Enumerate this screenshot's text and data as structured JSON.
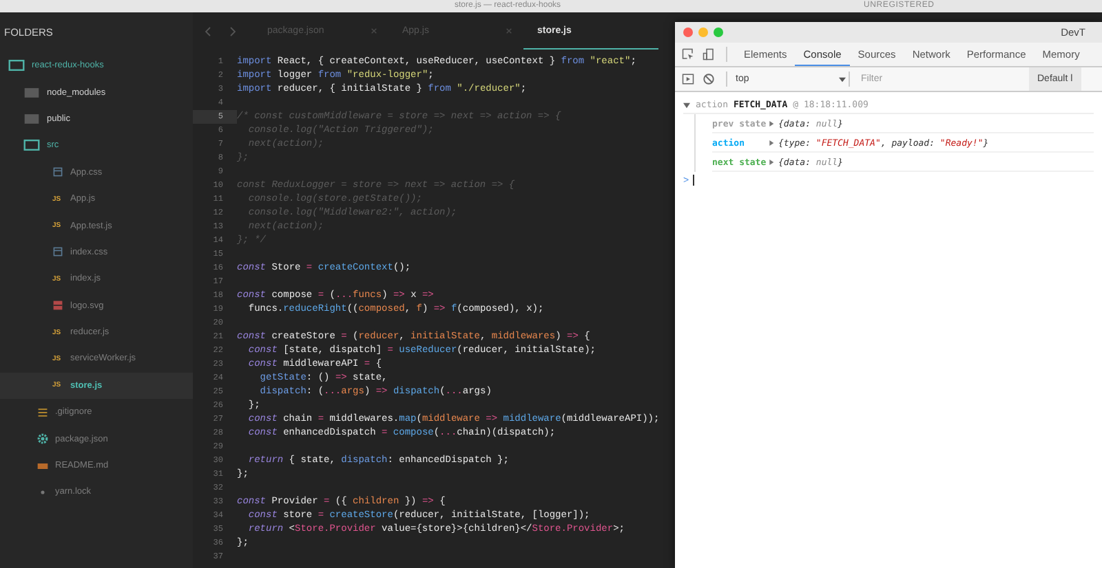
{
  "window": {
    "title": "store.js — react-redux-hooks",
    "license": "UNREGISTERED"
  },
  "sidebar": {
    "heading": "FOLDERS",
    "items": [
      {
        "name": "react-redux-hooks",
        "kind": "folder",
        "expanded": true,
        "selected": false,
        "children": [
          {
            "name": "node_modules",
            "kind": "folder",
            "expanded": false,
            "selected": false
          },
          {
            "name": "public",
            "kind": "folder",
            "expanded": false,
            "selected": false
          },
          {
            "name": "src",
            "kind": "folder",
            "expanded": true,
            "selected": false,
            "children": [
              {
                "name": "App.css",
                "kind": "css",
                "selected": false
              },
              {
                "name": "App.js",
                "kind": "js",
                "badge": "JS",
                "selected": false
              },
              {
                "name": "App.test.js",
                "kind": "js",
                "badge": "JS",
                "selected": false
              },
              {
                "name": "index.css",
                "kind": "css",
                "selected": false
              },
              {
                "name": "index.js",
                "kind": "js",
                "badge": "JS",
                "selected": false
              },
              {
                "name": "logo.svg",
                "kind": "image",
                "selected": false
              },
              {
                "name": "reducer.js",
                "kind": "js",
                "badge": "JS",
                "selected": false
              },
              {
                "name": "serviceWorker.js",
                "kind": "js",
                "badge": "JS",
                "selected": false
              },
              {
                "name": "store.js",
                "kind": "js",
                "badge": "JS",
                "selected": true
              }
            ]
          },
          {
            "name": ".gitignore",
            "kind": "text",
            "selected": false
          },
          {
            "name": "package.json",
            "kind": "json",
            "selected": false
          },
          {
            "name": "README.md",
            "kind": "markdown",
            "selected": false
          },
          {
            "name": "yarn.lock",
            "kind": "lock",
            "selected": false
          }
        ]
      }
    ]
  },
  "tabs": [
    {
      "label": "package.json",
      "selected": false
    },
    {
      "label": "App.js",
      "selected": false
    },
    {
      "label": "store.js",
      "selected": true
    }
  ],
  "code": [
    {
      "number": "1",
      "current": false,
      "tokens": [
        {
          "kind": "module",
          "text": "import"
        },
        {
          "kind": "plain",
          "text": " React, { createContext, useReducer, useContext } "
        },
        {
          "kind": "module",
          "text": "from"
        },
        {
          "kind": "string",
          "text": " \"react\""
        },
        {
          "kind": "plain",
          "text": ";"
        }
      ]
    },
    {
      "number": "2",
      "current": false,
      "tokens": [
        {
          "kind": "module",
          "text": "import"
        },
        {
          "kind": "plain",
          "text": " logger "
        },
        {
          "kind": "module",
          "text": "from"
        },
        {
          "kind": "string",
          "text": " \"redux-logger\""
        },
        {
          "kind": "plain",
          "text": ";"
        }
      ]
    },
    {
      "number": "3",
      "current": false,
      "tokens": [
        {
          "kind": "module",
          "text": "import"
        },
        {
          "kind": "plain",
          "text": " reducer, { initialState } "
        },
        {
          "kind": "module",
          "text": "from"
        },
        {
          "kind": "string",
          "text": " \"./reducer\""
        },
        {
          "kind": "plain",
          "text": ";"
        }
      ]
    },
    {
      "number": "4",
      "current": false
    },
    {
      "number": "5",
      "current": true,
      "tokens": [
        {
          "kind": "comment",
          "text": "/* const customMiddleware = store => next => action => {"
        }
      ]
    },
    {
      "number": "6",
      "current": false,
      "tokens": [
        {
          "kind": "comment",
          "text": "  console.log(\"Action Triggered\");"
        }
      ]
    },
    {
      "number": "7",
      "current": false,
      "tokens": [
        {
          "kind": "comment",
          "text": "  next(action);"
        }
      ]
    },
    {
      "number": "8",
      "current": false,
      "tokens": [
        {
          "kind": "comment",
          "text": "};"
        }
      ]
    },
    {
      "number": "9",
      "current": false
    },
    {
      "number": "10",
      "current": false,
      "tokens": [
        {
          "kind": "comment",
          "text": "const ReduxLogger = store => next => action => {"
        }
      ]
    },
    {
      "number": "11",
      "current": false,
      "tokens": [
        {
          "kind": "comment",
          "text": "  console.log(store.getState());"
        }
      ]
    },
    {
      "number": "12",
      "current": false,
      "tokens": [
        {
          "kind": "comment",
          "text": "  console.log(\"Middleware2:\", action);"
        }
      ]
    },
    {
      "number": "13",
      "current": false,
      "tokens": [
        {
          "kind": "comment",
          "text": "  next(action);"
        }
      ]
    },
    {
      "number": "14",
      "current": false,
      "tokens": [
        {
          "kind": "comment",
          "text": "}; */"
        }
      ]
    },
    {
      "number": "15",
      "current": false
    },
    {
      "number": "16",
      "current": false,
      "tokens": [
        {
          "kind": "keyword",
          "text": "const"
        },
        {
          "kind": "plain",
          "text": " Store "
        },
        {
          "kind": "operator",
          "text": "="
        },
        {
          "kind": "call",
          "text": " createContext"
        },
        {
          "kind": "plain",
          "text": "();"
        }
      ]
    },
    {
      "number": "17",
      "current": false
    },
    {
      "number": "18",
      "current": false,
      "tokens": [
        {
          "kind": "keyword",
          "text": "const"
        },
        {
          "kind": "plain",
          "text": " compose "
        },
        {
          "kind": "operator",
          "text": "="
        },
        {
          "kind": "plain",
          "text": " ("
        },
        {
          "kind": "operator",
          "text": "..."
        },
        {
          "kind": "param",
          "text": "funcs"
        },
        {
          "kind": "plain",
          "text": ") "
        },
        {
          "kind": "operator",
          "text": "=>"
        },
        {
          "kind": "plain",
          "text": " x "
        },
        {
          "kind": "operator",
          "text": "=>"
        }
      ]
    },
    {
      "number": "19",
      "current": false,
      "tokens": [
        {
          "kind": "plain",
          "text": "  funcs."
        },
        {
          "kind": "call",
          "text": "reduceRight"
        },
        {
          "kind": "plain",
          "text": "(("
        },
        {
          "kind": "param",
          "text": "composed"
        },
        {
          "kind": "plain",
          "text": ", "
        },
        {
          "kind": "param",
          "text": "f"
        },
        {
          "kind": "plain",
          "text": ") "
        },
        {
          "kind": "operator",
          "text": "=>"
        },
        {
          "kind": "call",
          "text": " f"
        },
        {
          "kind": "plain",
          "text": "(composed), x);"
        }
      ]
    },
    {
      "number": "20",
      "current": false
    },
    {
      "number": "21",
      "current": false,
      "tokens": [
        {
          "kind": "keyword",
          "text": "const"
        },
        {
          "kind": "plain",
          "text": " createStore "
        },
        {
          "kind": "operator",
          "text": "="
        },
        {
          "kind": "plain",
          "text": " ("
        },
        {
          "kind": "param",
          "text": "reducer"
        },
        {
          "kind": "plain",
          "text": ", "
        },
        {
          "kind": "param",
          "text": "initialState"
        },
        {
          "kind": "plain",
          "text": ", "
        },
        {
          "kind": "param",
          "text": "middlewares"
        },
        {
          "kind": "plain",
          "text": ") "
        },
        {
          "kind": "operator",
          "text": "=>"
        },
        {
          "kind": "plain",
          "text": " {"
        }
      ]
    },
    {
      "number": "22",
      "current": false,
      "tokens": [
        {
          "kind": "keyword",
          "text": "  const"
        },
        {
          "kind": "plain",
          "text": " [state, dispatch] "
        },
        {
          "kind": "operator",
          "text": "="
        },
        {
          "kind": "call",
          "text": " useReducer"
        },
        {
          "kind": "plain",
          "text": "(reducer, initialState);"
        }
      ]
    },
    {
      "number": "23",
      "current": false,
      "tokens": [
        {
          "kind": "keyword",
          "text": "  const"
        },
        {
          "kind": "plain",
          "text": " middlewareAPI "
        },
        {
          "kind": "operator",
          "text": "="
        },
        {
          "kind": "plain",
          "text": " {"
        }
      ]
    },
    {
      "number": "24",
      "current": false,
      "tokens": [
        {
          "kind": "property",
          "text": "    getState"
        },
        {
          "kind": "plain",
          "text": ": () "
        },
        {
          "kind": "operator",
          "text": "=>"
        },
        {
          "kind": "plain",
          "text": " state,"
        }
      ]
    },
    {
      "number": "25",
      "current": false,
      "tokens": [
        {
          "kind": "property",
          "text": "    dispatch"
        },
        {
          "kind": "plain",
          "text": ": ("
        },
        {
          "kind": "operator",
          "text": "..."
        },
        {
          "kind": "param",
          "text": "args"
        },
        {
          "kind": "plain",
          "text": ") "
        },
        {
          "kind": "operator",
          "text": "=>"
        },
        {
          "kind": "call",
          "text": " dispatch"
        },
        {
          "kind": "plain",
          "text": "("
        },
        {
          "kind": "operator",
          "text": "..."
        },
        {
          "kind": "plain",
          "text": "args)"
        }
      ]
    },
    {
      "number": "26",
      "current": false,
      "tokens": [
        {
          "kind": "plain",
          "text": "  };"
        }
      ]
    },
    {
      "number": "27",
      "current": false,
      "tokens": [
        {
          "kind": "keyword",
          "text": "  const"
        },
        {
          "kind": "plain",
          "text": " chain "
        },
        {
          "kind": "operator",
          "text": "="
        },
        {
          "kind": "plain",
          "text": " middlewares."
        },
        {
          "kind": "call",
          "text": "map"
        },
        {
          "kind": "plain",
          "text": "("
        },
        {
          "kind": "param",
          "text": "middleware"
        },
        {
          "kind": "operator",
          "text": " =>"
        },
        {
          "kind": "call",
          "text": " middleware"
        },
        {
          "kind": "plain",
          "text": "(middlewareAPI));"
        }
      ]
    },
    {
      "number": "28",
      "current": false,
      "tokens": [
        {
          "kind": "keyword",
          "text": "  const"
        },
        {
          "kind": "plain",
          "text": " enhancedDispatch "
        },
        {
          "kind": "operator",
          "text": "="
        },
        {
          "kind": "call",
          "text": " compose"
        },
        {
          "kind": "plain",
          "text": "("
        },
        {
          "kind": "operator",
          "text": "..."
        },
        {
          "kind": "plain",
          "text": "chain)(dispatch);"
        }
      ]
    },
    {
      "number": "29",
      "current": false
    },
    {
      "number": "30",
      "current": false,
      "tokens": [
        {
          "kind": "keyword",
          "text": "  return"
        },
        {
          "kind": "plain",
          "text": " { state, "
        },
        {
          "kind": "property",
          "text": "dispatch"
        },
        {
          "kind": "plain",
          "text": ": enhancedDispatch };"
        }
      ]
    },
    {
      "number": "31",
      "current": false,
      "tokens": [
        {
          "kind": "plain",
          "text": "};"
        }
      ]
    },
    {
      "number": "32",
      "current": false
    },
    {
      "number": "33",
      "current": false,
      "tokens": [
        {
          "kind": "keyword",
          "text": "const"
        },
        {
          "kind": "plain",
          "text": " Provider "
        },
        {
          "kind": "operator",
          "text": "="
        },
        {
          "kind": "plain",
          "text": " ({ "
        },
        {
          "kind": "param",
          "text": "children"
        },
        {
          "kind": "plain",
          "text": " }) "
        },
        {
          "kind": "operator",
          "text": "=>"
        },
        {
          "kind": "plain",
          "text": " {"
        }
      ]
    },
    {
      "number": "34",
      "current": false,
      "tokens": [
        {
          "kind": "keyword",
          "text": "  const"
        },
        {
          "kind": "plain",
          "text": " store "
        },
        {
          "kind": "operator",
          "text": "="
        },
        {
          "kind": "call",
          "text": " createStore"
        },
        {
          "kind": "plain",
          "text": "(reducer, initialState, [logger]);"
        }
      ]
    },
    {
      "number": "35",
      "current": false,
      "tokens": [
        {
          "kind": "keyword",
          "text": "  return"
        },
        {
          "kind": "plain",
          "text": " <"
        },
        {
          "kind": "tag",
          "text": "Store.Provider"
        },
        {
          "kind": "plain",
          "text": " value={store}>{children}</"
        },
        {
          "kind": "tag",
          "text": "Store.Provider"
        },
        {
          "kind": "plain",
          "text": ">;"
        }
      ]
    },
    {
      "number": "36",
      "current": false,
      "tokens": [
        {
          "kind": "plain",
          "text": "};"
        }
      ]
    },
    {
      "number": "37",
      "current": false
    }
  ],
  "devtools": {
    "title": "DevT",
    "tabs": [
      {
        "label": "Elements",
        "selected": false
      },
      {
        "label": "Console",
        "selected": true
      },
      {
        "label": "Sources",
        "selected": false
      },
      {
        "label": "Network",
        "selected": false
      },
      {
        "label": "Performance",
        "selected": false
      },
      {
        "label": "Memory",
        "selected": false
      }
    ],
    "context": "top",
    "filter": {
      "placeholder": "Filter"
    },
    "levels": "Default l",
    "log": {
      "expanded": true,
      "prefix": "action",
      "type": "FETCH_DATA",
      "time": "@ 18:18:11.009",
      "rows": [
        {
          "label": "prev state",
          "color": "#9e9e9e",
          "expanded": false,
          "value": [
            {
              "kind": "plain",
              "text": "{data: "
            },
            {
              "kind": "null",
              "text": "null"
            },
            {
              "kind": "plain",
              "text": "}"
            }
          ]
        },
        {
          "label": "action",
          "color": "#03a9f4",
          "expanded": false,
          "value": [
            {
              "kind": "plain",
              "text": "{type: "
            },
            {
              "kind": "string",
              "text": "\"FETCH_DATA\""
            },
            {
              "kind": "plain",
              "text": ", payload: "
            },
            {
              "kind": "string",
              "text": "\"Ready!\""
            },
            {
              "kind": "plain",
              "text": "}"
            }
          ]
        },
        {
          "label": "next state",
          "color": "#4caf50",
          "expanded": false,
          "value": [
            {
              "kind": "plain",
              "text": "{data: "
            },
            {
              "kind": "null",
              "text": "null"
            },
            {
              "kind": "plain",
              "text": "}"
            }
          ]
        }
      ]
    },
    "prompt": ">"
  }
}
